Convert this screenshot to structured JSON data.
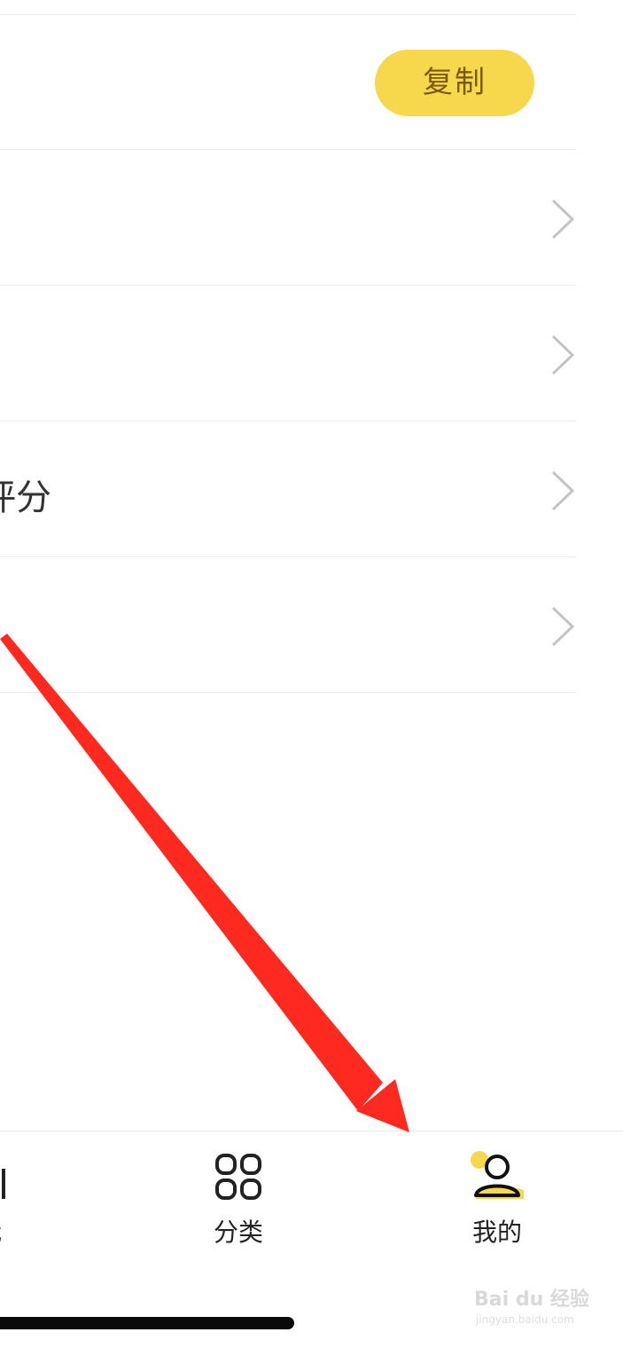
{
  "list": {
    "copy_button_label": "复制",
    "rows": [
      {
        "text": ""
      },
      {
        "text": ""
      },
      {
        "text": "评分"
      },
      {
        "text": ""
      }
    ]
  },
  "tabbar": {
    "tabs": [
      {
        "label": "我",
        "icon": "bookshelf-icon",
        "partial": true
      },
      {
        "label": "分类",
        "icon": "category-grid-icon"
      },
      {
        "label": "我的",
        "icon": "profile-icon",
        "active": true
      }
    ]
  },
  "colors": {
    "accent": "#f7d84c",
    "annotation_arrow": "#ff2a1f"
  },
  "watermark": {
    "brand": "Bai du 经验",
    "url": "jingyan.baidu.com"
  }
}
